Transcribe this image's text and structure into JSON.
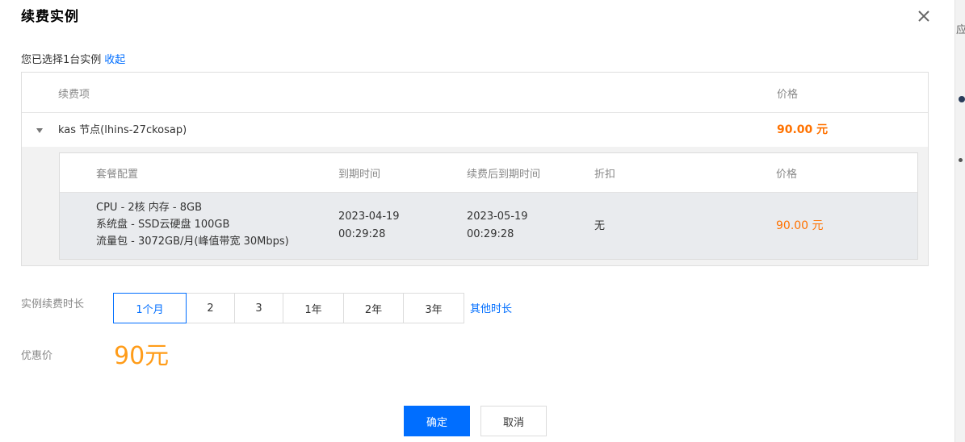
{
  "background": {
    "glyph": "应用"
  },
  "dialog": {
    "title": "续费实例",
    "close_icon": "close-icon",
    "selected_text": "您已选择1台实例",
    "collapse_link": "收起"
  },
  "outer_table": {
    "headers": {
      "item": "续费项",
      "price": "价格"
    },
    "row": {
      "name": "kas 节点(lhins-27ckosap)",
      "price": "90.00 元"
    }
  },
  "inner_table": {
    "headers": {
      "config": "套餐配置",
      "expire": "到期时间",
      "after_expire": "续费后到期时间",
      "discount": "折扣",
      "price": "价格"
    },
    "row": {
      "config_lines": [
        "CPU - 2核 内存 - 8GB",
        "系统盘 - SSD云硬盘 100GB",
        "流量包 - 3072GB/月(峰值带宽 30Mbps)"
      ],
      "expire_date": "2023-04-19",
      "expire_time": "00:29:28",
      "after_date": "2023-05-19",
      "after_time": "00:29:28",
      "discount": "无",
      "price": "90.00 元"
    }
  },
  "duration": {
    "label": "实例续费时长",
    "options": [
      "1个月",
      "2",
      "3",
      "1年",
      "2年",
      "3年"
    ],
    "selected": "1个月",
    "other_link": "其他时长"
  },
  "discount_price": {
    "label": "优惠价",
    "value": "90元"
  },
  "buttons": {
    "confirm": "确定",
    "cancel": "取消"
  },
  "colors": {
    "primary": "#006eff",
    "price_orange": "#ff7200",
    "discount_price": "#ff9c19"
  }
}
